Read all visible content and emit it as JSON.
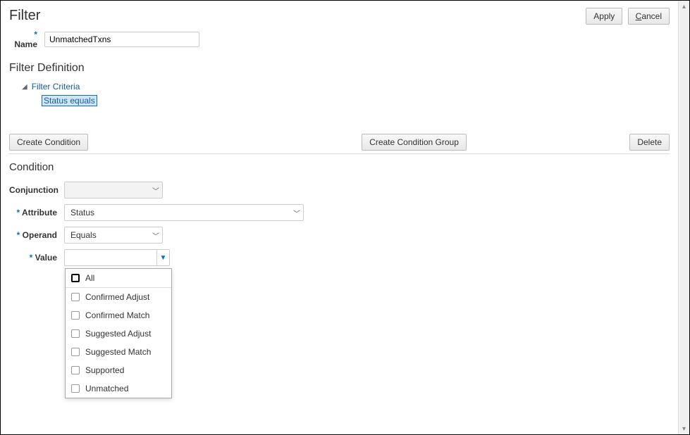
{
  "header": {
    "title": "Filter",
    "apply_label": "Apply",
    "cancel_prefix": "C",
    "cancel_rest": "ancel"
  },
  "name": {
    "label": "Name",
    "value": "UnmatchedTxns"
  },
  "definition_heading": "Filter Definition",
  "tree": {
    "root_label": "Filter Criteria",
    "child_label": "Status equals"
  },
  "action_row": {
    "create_condition": "Create Condition",
    "create_condition_group": "Create Condition Group",
    "delete": "Delete"
  },
  "condition": {
    "heading": "Condition",
    "conjunction_label": "Conjunction",
    "conjunction_value": "",
    "attribute_label": "Attribute",
    "attribute_value": "Status",
    "operand_label": "Operand",
    "operand_value": "Equals",
    "value_label": "Value",
    "value_value": ""
  },
  "value_options": [
    "All",
    "Confirmed Adjust",
    "Confirmed Match",
    "Suggested Adjust",
    "Suggested Match",
    "Supported",
    "Unmatched"
  ]
}
